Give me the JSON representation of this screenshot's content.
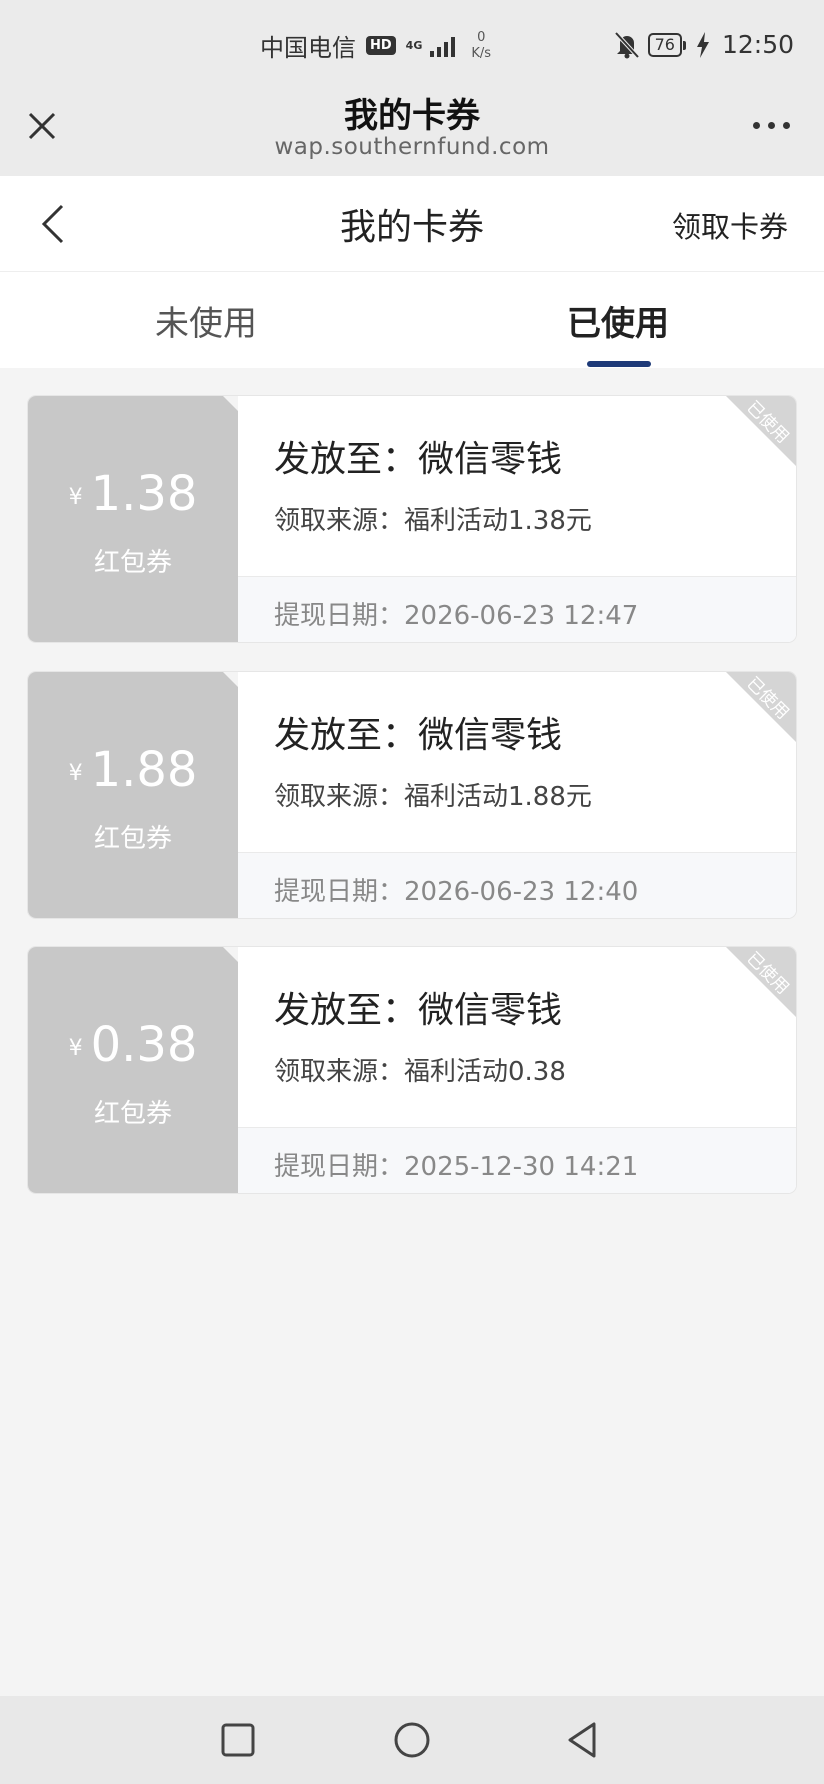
{
  "status_bar": {
    "carrier": "中国电信",
    "hd_badge": "HD",
    "network": "4G",
    "speed_value": "0",
    "speed_unit": "K/s",
    "battery": "76",
    "time": "12:50"
  },
  "browser": {
    "title": "我的卡券",
    "url": "wap.southernfund.com"
  },
  "header": {
    "title": "我的卡券",
    "claim_label": "领取卡券"
  },
  "tabs": [
    {
      "label": "未使用",
      "active": false
    },
    {
      "label": "已使用",
      "active": true
    }
  ],
  "coupons": [
    {
      "currency": "¥",
      "amount": "1.38",
      "type": "红包券",
      "target": "发放至：微信零钱",
      "source": "领取来源：福利活动1.38元",
      "date": "提现日期：2026-06-23 12:47",
      "stamp": "已使用"
    },
    {
      "currency": "¥",
      "amount": "1.88",
      "type": "红包券",
      "target": "发放至：微信零钱",
      "source": "领取来源：福利活动1.88元",
      "date": "提现日期：2026-06-23 12:40",
      "stamp": "已使用"
    },
    {
      "currency": "¥",
      "amount": "0.38",
      "type": "红包券",
      "target": "发放至：微信零钱",
      "source": "领取来源：福利活动0.38",
      "date": "提现日期：2025-12-30 14:21",
      "stamp": "已使用"
    }
  ],
  "colors": {
    "accent": "#1e3a78",
    "coupon_used_bg": "#c8c8c8",
    "page_bg": "#f4f4f4"
  }
}
